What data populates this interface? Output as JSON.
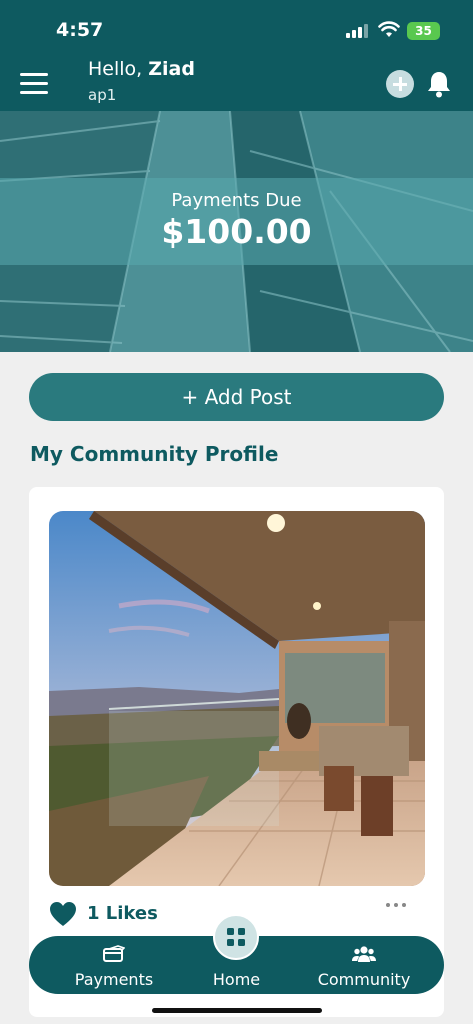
{
  "status_bar": {
    "time": "4:57",
    "battery": "35"
  },
  "header": {
    "greeting_prefix": "Hello, ",
    "user_name": "Ziad",
    "subtitle": "ap1"
  },
  "payments_due": {
    "label": "Payments Due",
    "amount": "$100.00"
  },
  "add_post": {
    "label": "+ Add Post"
  },
  "section": {
    "title": "My Community Profile"
  },
  "post": {
    "likes_text": "1 Likes"
  },
  "bottom_nav": {
    "items": [
      {
        "label": "Payments",
        "icon": "payments-icon"
      },
      {
        "label": "Home",
        "icon": "grid-icon"
      },
      {
        "label": "Community",
        "icon": "people-icon"
      }
    ]
  },
  "colors": {
    "primary": "#0e5a60",
    "accent": "#2a7a7e",
    "background": "#efefef"
  }
}
